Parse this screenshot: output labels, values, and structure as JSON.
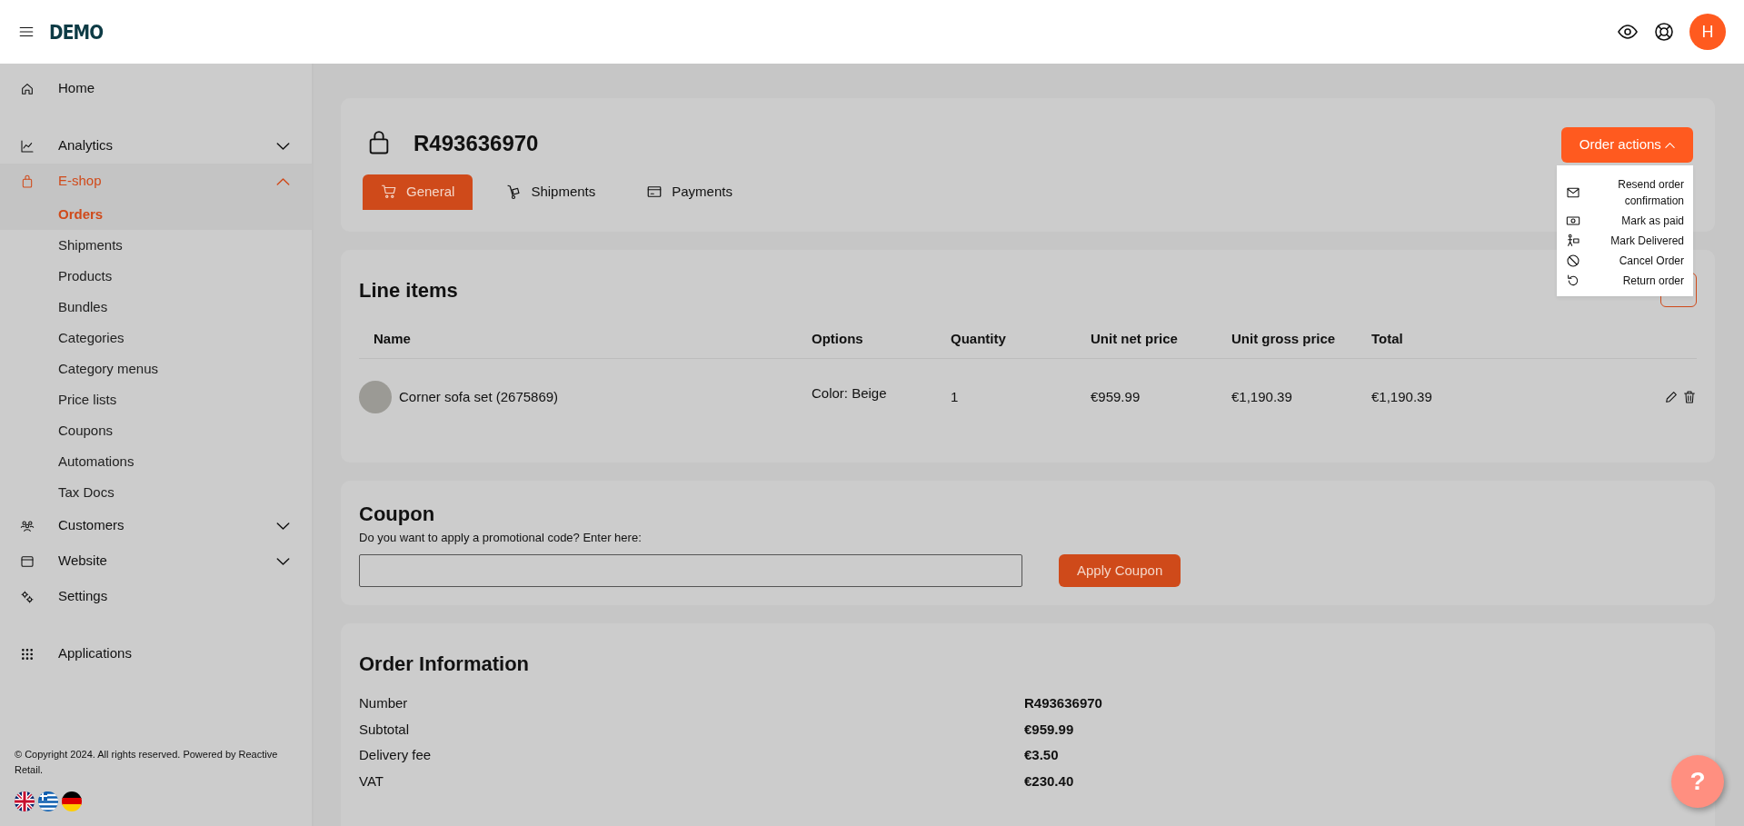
{
  "header": {
    "logo": "DEMO",
    "avatar": "H"
  },
  "sidebar": {
    "groups": [
      [
        {
          "label": "Home",
          "selected": false
        }
      ],
      [
        {
          "label": "Analytics",
          "selected": false,
          "expanded": false
        },
        {
          "label": "E-shop",
          "selected": true,
          "expanded": true,
          "children": [
            {
              "label": "Orders",
              "selected": true
            },
            {
              "label": "Shipments",
              "selected": false
            },
            {
              "label": "Products",
              "selected": false
            },
            {
              "label": "Bundles",
              "selected": false
            },
            {
              "label": "Categories",
              "selected": false
            },
            {
              "label": "Category menus",
              "selected": false
            },
            {
              "label": "Price lists",
              "selected": false
            },
            {
              "label": "Coupons",
              "selected": false
            },
            {
              "label": "Automations",
              "selected": false
            },
            {
              "label": "Tax Docs",
              "selected": false
            }
          ]
        },
        {
          "label": "Customers",
          "selected": false,
          "expanded": false
        },
        {
          "label": "Website",
          "selected": false,
          "expanded": false
        },
        {
          "label": "Settings",
          "selected": false
        }
      ],
      [
        {
          "label": "Applications",
          "selected": false
        }
      ]
    ],
    "copyright": "© Copyright 2024. All rights reserved. Powered by Reactive Retail."
  },
  "order": {
    "number": "R493636970",
    "tabs": [
      {
        "label": "General",
        "selected": true
      },
      {
        "label": "Shipments",
        "selected": false
      },
      {
        "label": "Payments",
        "selected": false
      }
    ],
    "actions_button": "Order actions",
    "actions_menu": {
      "expanded": true,
      "items": [
        "Resend order confirmation",
        "Mark as paid",
        "Mark Delivered",
        "Cancel Order",
        "Return order"
      ]
    }
  },
  "line_items": {
    "title": "Line items",
    "columns": [
      "Name",
      "Options",
      "Quantity",
      "Unit net price",
      "Unit gross price",
      "Total"
    ],
    "rows": [
      {
        "name": "Corner sofa set (2675869)",
        "options": "Color: Beige",
        "quantity": "1",
        "unit_net": "€959.99",
        "unit_gross": "€1,190.39",
        "total": "€1,190.39"
      }
    ]
  },
  "coupon": {
    "title": "Coupon",
    "prompt": "Do you want to apply a promotional code? Enter here:",
    "button": "Apply Coupon"
  },
  "order_information": {
    "title": "Order Information",
    "rows": [
      {
        "label": "Number",
        "value": "R493636970"
      },
      {
        "label": "Subtotal",
        "value": "€959.99"
      },
      {
        "label": "Delivery fee",
        "value": "€3.50"
      },
      {
        "label": "VAT",
        "value": "€230.40"
      }
    ]
  },
  "help_button": "?"
}
